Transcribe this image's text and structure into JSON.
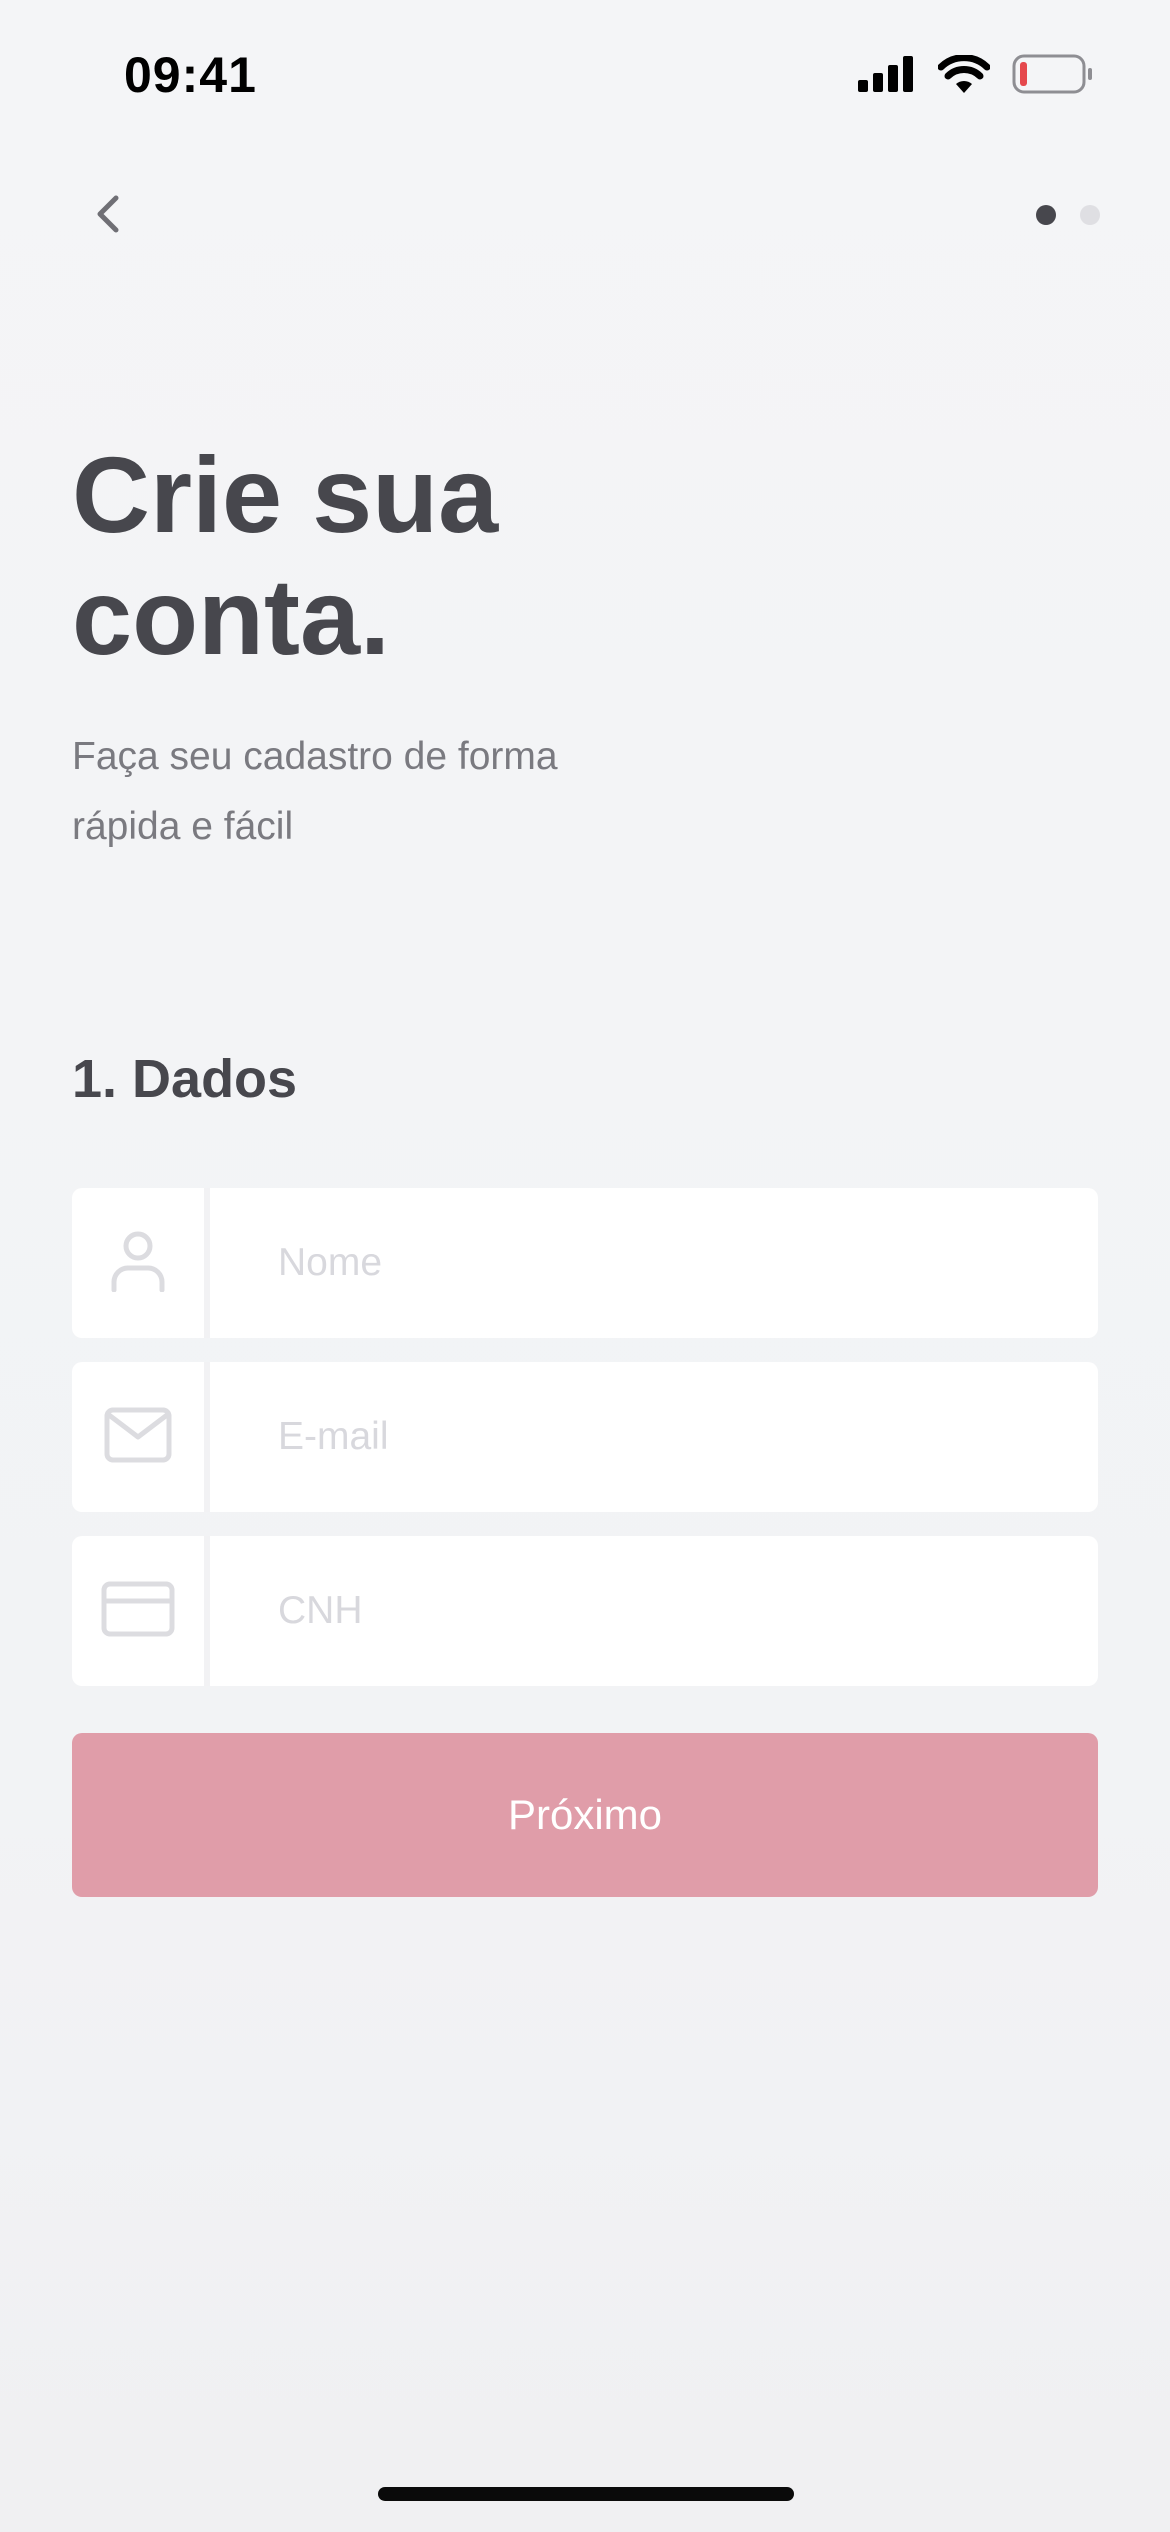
{
  "status_bar": {
    "time": "09:41",
    "icons": [
      "signal-icon",
      "wifi-icon",
      "battery-icon"
    ],
    "battery_color": "#e5484d"
  },
  "header": {
    "back_icon": "chevron-left-icon",
    "pagination": {
      "total": 2,
      "active": 1,
      "active_color": "#47474d",
      "inactive_color": "#dfdfe3"
    }
  },
  "main": {
    "title": "Crie sua conta.",
    "subtitle": "Faça seu cadastro de forma rápida e fácil",
    "section_title": "1. Dados",
    "fields": [
      {
        "icon": "user-icon",
        "placeholder": "Nome",
        "value": ""
      },
      {
        "icon": "mail-icon",
        "placeholder": "E-mail",
        "value": ""
      },
      {
        "icon": "card-icon",
        "placeholder": "CNH",
        "value": ""
      }
    ],
    "next_button": {
      "label": "Próximo",
      "color": "#e09da9"
    }
  }
}
